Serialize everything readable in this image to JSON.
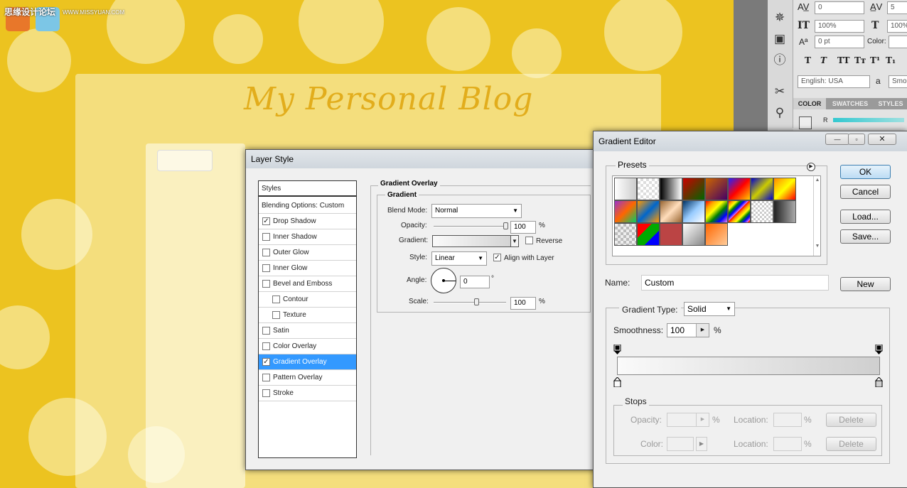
{
  "watermark": {
    "site_cn": "思缘设计论坛",
    "site_url": "WWW.MISSYUAN.COM"
  },
  "canvas": {
    "blog_title": "My Personal Blog"
  },
  "ps_panel": {
    "tracking": "0",
    "kerning": "5",
    "vscale": "100%",
    "hscale": "100%",
    "baseline": "0 pt",
    "color_label": "Color:",
    "language": "English: USA",
    "aa_glyph": "a",
    "aa_value": "Smo",
    "tabs": [
      "COLOR",
      "SWATCHES",
      "STYLES"
    ],
    "channel_r": "R"
  },
  "layer_style": {
    "title": "Layer Style",
    "styles_header": "Styles",
    "items": [
      {
        "label": "Blending Options: Custom",
        "check": "none",
        "active": false,
        "indent": false
      },
      {
        "label": "Drop Shadow",
        "check": "on",
        "active": false,
        "indent": false
      },
      {
        "label": "Inner Shadow",
        "check": "off",
        "active": false,
        "indent": false
      },
      {
        "label": "Outer Glow",
        "check": "off",
        "active": false,
        "indent": false
      },
      {
        "label": "Inner Glow",
        "check": "off",
        "active": false,
        "indent": false
      },
      {
        "label": "Bevel and Emboss",
        "check": "off",
        "active": false,
        "indent": false
      },
      {
        "label": "Contour",
        "check": "off",
        "active": false,
        "indent": true
      },
      {
        "label": "Texture",
        "check": "off",
        "active": false,
        "indent": true
      },
      {
        "label": "Satin",
        "check": "off",
        "active": false,
        "indent": false
      },
      {
        "label": "Color Overlay",
        "check": "off",
        "active": false,
        "indent": false
      },
      {
        "label": "Gradient Overlay",
        "check": "on",
        "active": true,
        "indent": false
      },
      {
        "label": "Pattern Overlay",
        "check": "off",
        "active": false,
        "indent": false
      },
      {
        "label": "Stroke",
        "check": "off",
        "active": false,
        "indent": false
      }
    ],
    "section_title": "Gradient Overlay",
    "group_title": "Gradient",
    "blend_mode_label": "Blend Mode:",
    "blend_mode": "Normal",
    "opacity_label": "Opacity:",
    "opacity": "100",
    "pct": "%",
    "opacity_level": 1.0,
    "gradient_label": "Gradient:",
    "reverse_label": "Reverse",
    "style_label": "Style:",
    "style": "Linear",
    "align_label": "Align with Layer",
    "angle_label": "Angle:",
    "angle": "0",
    "degree": "°",
    "scale_label": "Scale:",
    "scale": "100",
    "scale_level": 0.6
  },
  "gradient_editor": {
    "title": "Gradient Editor",
    "presets_label": "Presets",
    "ok": "OK",
    "cancel": "Cancel",
    "load": "Load...",
    "save": "Save...",
    "name_label": "Name:",
    "name_value": "Custom",
    "new": "New",
    "gradient_type_label": "Gradient Type:",
    "gradient_type": "Solid",
    "smoothness_label": "Smoothness:",
    "smoothness": "100",
    "pct": "%",
    "stops_label": "Stops",
    "opacity_label": "Opacity:",
    "location_label": "Location:",
    "color_label": "Color:",
    "delete": "Delete"
  }
}
